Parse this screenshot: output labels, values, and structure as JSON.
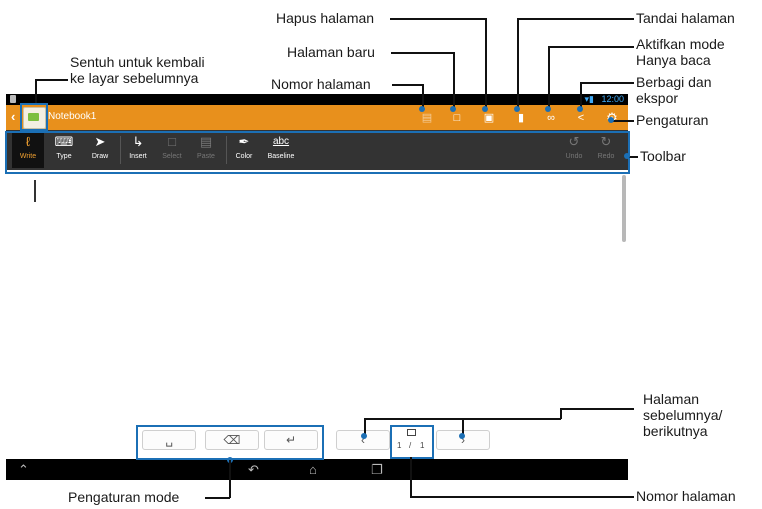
{
  "callouts": {
    "back": "Sentuh untuk kembali\nke layar sebelumnya",
    "page_number_top": "Nomor halaman",
    "new_page": "Halaman baru",
    "delete_page": "Hapus halaman",
    "bookmark": "Tandai halaman",
    "read_only": "Aktifkan mode\nHanya baca",
    "share": "Berbagi dan\nekspor",
    "settings": "Pengaturan",
    "toolbar": "Toolbar",
    "prev_next": "Halaman\nsebelumnya/\nberikutnya",
    "page_number_bottom": "Nomor halaman",
    "mode_settings": "Pengaturan mode"
  },
  "status_bar": {
    "time": "12:00",
    "wifi_icon": "wifi-icon",
    "battery_icon": "battery-icon"
  },
  "action_bar": {
    "title": "Notebook1",
    "back_icon": "chevron-left-icon",
    "actions": [
      "page-number-icon",
      "new-page-icon",
      "delete-page-icon",
      "bookmark-icon",
      "read-only-icon",
      "share-icon",
      "settings-icon"
    ]
  },
  "toolbar": {
    "tools": [
      {
        "label": "Write",
        "icon": "pen-icon"
      },
      {
        "label": "Type",
        "icon": "keyboard-icon"
      },
      {
        "label": "Draw",
        "icon": "brush-icon"
      },
      {
        "label": "Insert",
        "icon": "insert-icon"
      },
      {
        "label": "Select",
        "icon": "select-icon"
      },
      {
        "label": "Paste",
        "icon": "paste-icon"
      },
      {
        "label": "Color",
        "icon": "color-pen-icon"
      },
      {
        "label": "Baseline",
        "icon": "baseline-icon"
      },
      {
        "label": "Undo",
        "icon": "undo-icon"
      },
      {
        "label": "Redo",
        "icon": "redo-icon"
      }
    ],
    "active_tool": "Write",
    "accent_color": "#e8901c"
  },
  "bottom_keys": {
    "space_icon": "space-icon",
    "backspace_icon": "backspace-icon",
    "enter_icon": "enter-icon",
    "prev_icon": "prev-page-icon",
    "next_icon": "next-page-icon",
    "page_current": "1",
    "page_separator": "/",
    "page_total": "1"
  },
  "nav_bar": {
    "icons": [
      "keyboard-hide-icon",
      "back-icon",
      "home-icon",
      "recent-apps-icon"
    ]
  }
}
